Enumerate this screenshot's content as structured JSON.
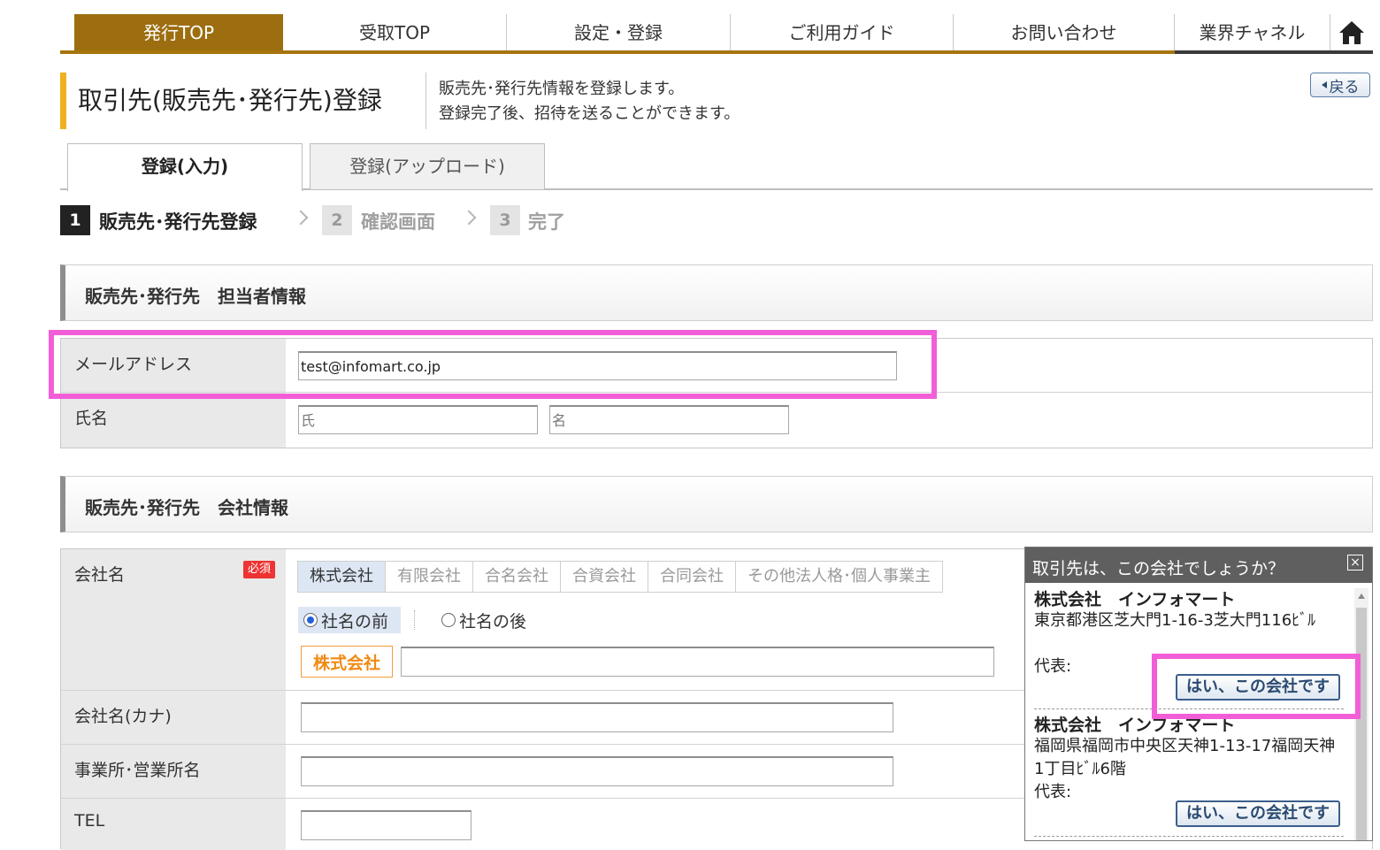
{
  "nav": {
    "items": [
      "発行TOP",
      "受取TOP",
      "設定・登録",
      "ご利用ガイド",
      "お問い合わせ",
      "業界チャネル"
    ],
    "home_icon": "home-icon"
  },
  "header": {
    "title": "取引先(販売先･発行先)登録",
    "desc1": "販売先･発行先情報を登録します。",
    "desc2": "登録完了後、招待を送ることができます。",
    "back_label": "戻る"
  },
  "tabs": [
    "登録(入力)",
    "登録(アップロード)"
  ],
  "steps": [
    {
      "num": "1",
      "label": "販売先･発行先登録"
    },
    {
      "num": "2",
      "label": "確認画面"
    },
    {
      "num": "3",
      "label": "完了"
    }
  ],
  "section1": {
    "title": "販売先･発行先　担当者情報",
    "email_label": "メールアドレス",
    "email_value": "test@infomart.co.jp",
    "name_label": "氏名",
    "last_name_placeholder": "氏",
    "first_name_placeholder": "名"
  },
  "section2": {
    "title": "販売先･発行先　会社情報",
    "company_label": "会社名",
    "required": "必須",
    "corp_types": [
      "株式会社",
      "有限会社",
      "合名会社",
      "合資会社",
      "合同会社",
      "その他法人格･個人事業主"
    ],
    "position_before": "社名の前",
    "position_after": "社名の後",
    "corp_badge": "株式会社",
    "kana_label": "会社名(カナ)",
    "office_label": "事業所･営業所名",
    "tel_label": "TEL"
  },
  "popup": {
    "title": "取引先は、この会社でしょうか？",
    "close": "×",
    "candidates": [
      {
        "name": "株式会社　インフォマート",
        "address": "東京都港区芝大門1-16-3芝大門116ﾋﾞﾙ",
        "rep": "代表:",
        "button": "はい、この会社です"
      },
      {
        "name": "株式会社　インフォマート",
        "address": "福岡県福岡市中央区天神1-13-17福岡天神1丁目ﾋﾞﾙ6階",
        "rep": "代表:",
        "button": "はい、この会社です"
      }
    ]
  },
  "colors": {
    "nav_active": "#9c6e10",
    "title_accent": "#f0b020",
    "highlight": "#f25ed7",
    "required": "#e33333"
  }
}
